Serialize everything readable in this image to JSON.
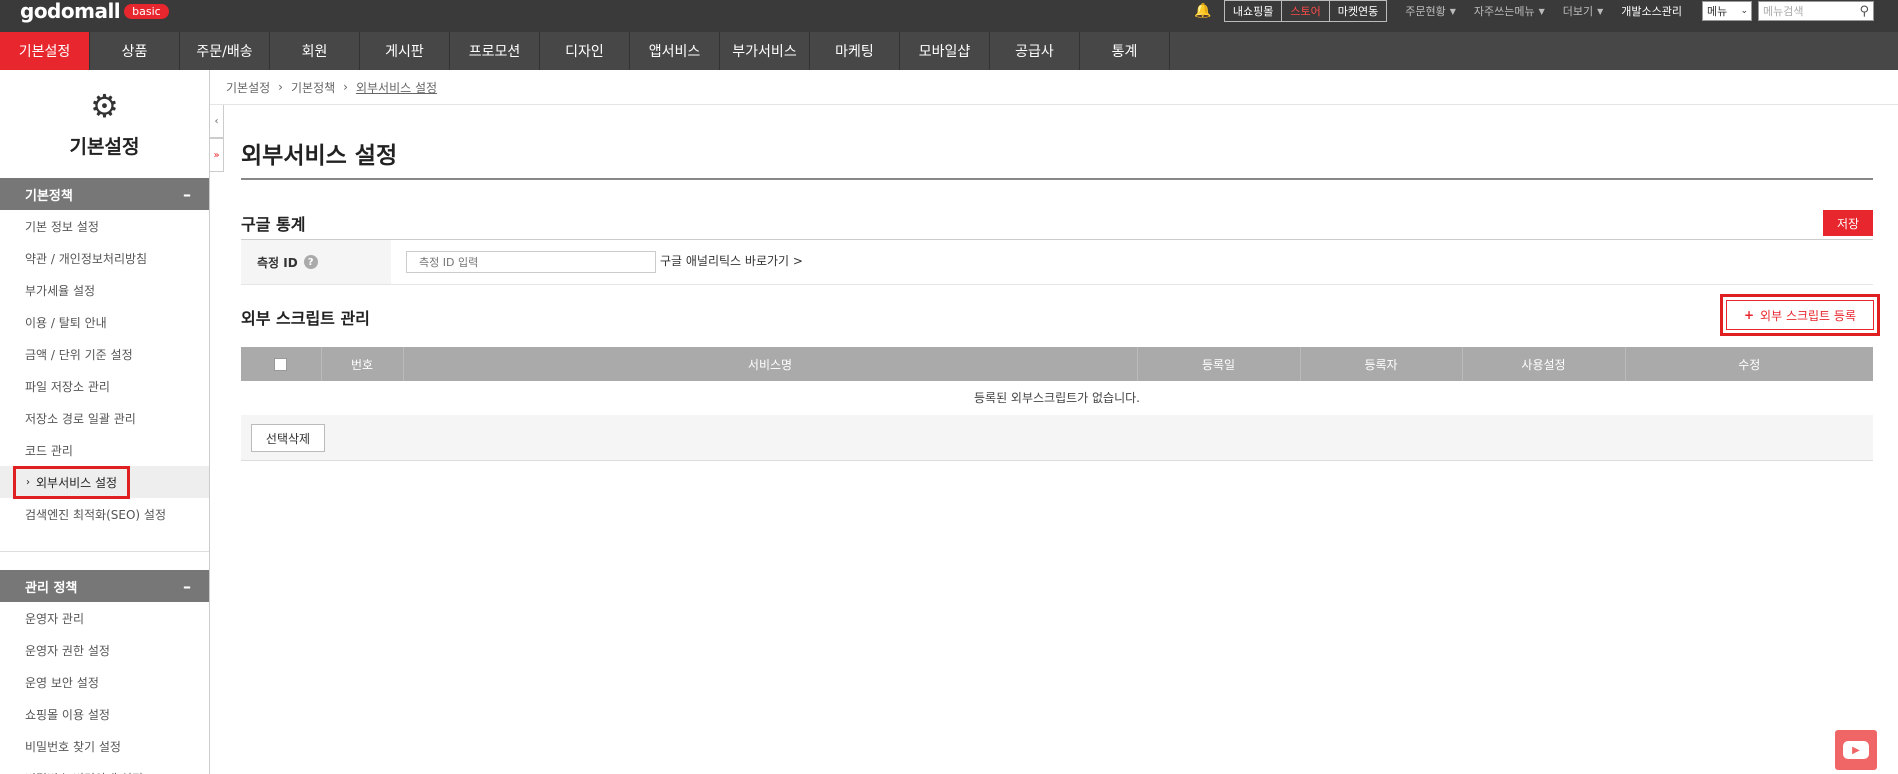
{
  "brand": {
    "logo": "godomall",
    "badge": "basic"
  },
  "topbar": {
    "buttons": [
      "내쇼핑몰",
      "스토어",
      "마켓연동"
    ],
    "links": [
      "주문현황",
      "자주쓰는메뉴",
      "더보기"
    ],
    "dev_link": "개발소스관리",
    "menu_select": "메뉴",
    "search_placeholder": "메뉴검색"
  },
  "nav": [
    "기본설정",
    "상품",
    "주문/배송",
    "회원",
    "게시판",
    "프로모션",
    "디자인",
    "앱서비스",
    "부가서비스",
    "마케팅",
    "모바일샵",
    "공급사",
    "통계"
  ],
  "sidebar": {
    "title": "기본설정",
    "group1": "기본정책",
    "items1": [
      "기본 정보 설정",
      "약관 / 개인정보처리방침",
      "부가세율 설정",
      "이용 / 탈퇴 안내",
      "금액 / 단위 기준 설정",
      "파일 저장소 관리",
      "저장소 경로 일괄 관리",
      "코드 관리",
      "외부서비스 설정",
      "검색엔진 최적화(SEO) 설정"
    ],
    "group2": "관리 정책",
    "items2": [
      "운영자 관리",
      "운영자 권한 설정",
      "운영 보안 설정",
      "쇼핑몰 이용 설정",
      "비밀번호 찾기 설정",
      "비밀번호 변경안내 설정"
    ]
  },
  "breadcrumb": [
    "기본설정",
    "기본정책",
    "외부서비스 설정"
  ],
  "page": {
    "title": "외부서비스 설정",
    "ga_section": "구글 통계",
    "save": "저장",
    "id_label": "측정 ID",
    "id_placeholder": "측정 ID 입력",
    "ga_link": "구글 애널리틱스 바로가기 >",
    "script_section": "외부 스크립트 관리",
    "add_button": "외부 스크립트 등록",
    "columns": [
      "번호",
      "서비스명",
      "등록일",
      "등록자",
      "사용설정",
      "수정"
    ],
    "empty": "등록된 외부스크립트가 없습니다.",
    "delete_button": "선택삭제"
  }
}
